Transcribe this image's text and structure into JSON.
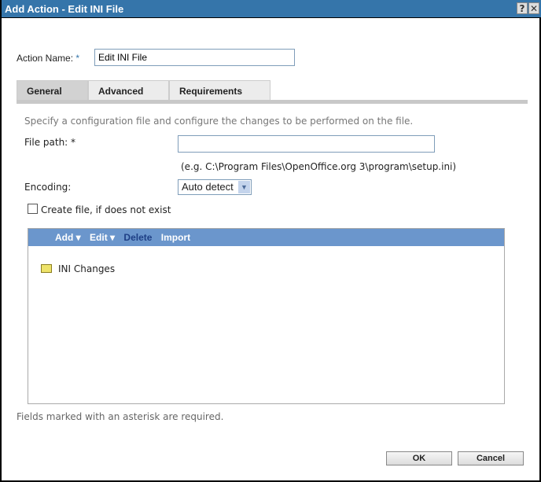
{
  "window": {
    "title": "Add Action - Edit INI File",
    "help_label": "?",
    "close_label": "✕"
  },
  "action_name": {
    "label": "Action Name:",
    "required_mark": "*",
    "value": "Edit INI File"
  },
  "tabs": [
    {
      "label": "General",
      "active": true
    },
    {
      "label": "Advanced"
    },
    {
      "label": "Requirements"
    }
  ],
  "general": {
    "description": "Specify a configuration file and configure the changes to be performed on the file.",
    "file_path": {
      "label": "File path:",
      "required_mark": "*",
      "value": "",
      "hint": "(e.g. C:\\Program Files\\OpenOffice.org 3\\program\\setup.ini)"
    },
    "encoding": {
      "label": "Encoding:",
      "selected": "Auto detect"
    },
    "create_file": {
      "label": "Create file, if does not exist",
      "checked": false
    }
  },
  "changes": {
    "toolbar": {
      "add": "Add",
      "edit": "Edit",
      "delete": "Delete",
      "import": "Import"
    },
    "items": [
      {
        "label": "INI Changes",
        "icon": "folder-icon"
      }
    ]
  },
  "footer": {
    "required_note": "Fields marked with an asterisk are required.",
    "ok": "OK",
    "cancel": "Cancel"
  }
}
